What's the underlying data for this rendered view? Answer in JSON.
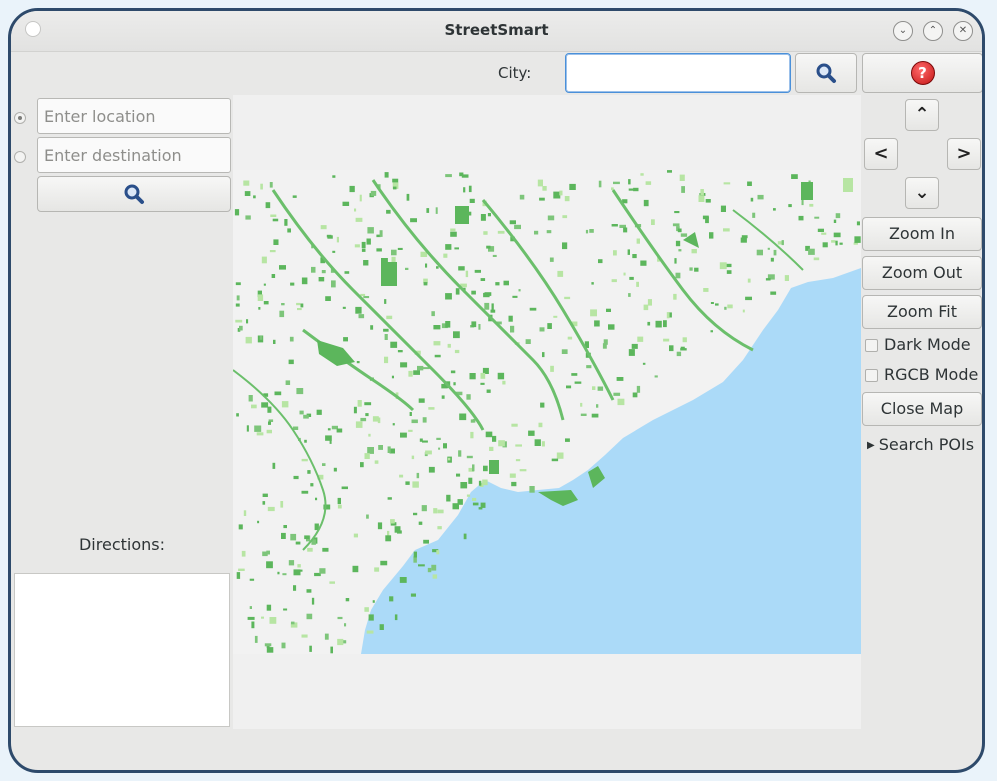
{
  "window": {
    "title": "StreetSmart"
  },
  "window_controls": [
    "minimize-icon",
    "maximize-icon",
    "close-icon"
  ],
  "search": {
    "city_label": "City:",
    "city_value": "",
    "city_placeholder": ""
  },
  "route": {
    "location_placeholder": "Enter location",
    "destination_placeholder": "Enter destination",
    "directions_label": "Directions:"
  },
  "controls": {
    "zoom_in": "Zoom In",
    "zoom_out": "Zoom Out",
    "zoom_fit": "Zoom Fit",
    "dark_mode": "Dark Mode",
    "rgcb_mode": "RGCB Mode",
    "close_map": "Close Map",
    "search_pois": "Search POIs",
    "pan_up": "⌃",
    "pan_down": "⌄",
    "pan_left": "<",
    "pan_right": ">",
    "help": "?"
  },
  "colors": {
    "land": "#f2f2f2",
    "water": "#abdaf8",
    "park": "#5cb65c",
    "grass": "#b7e5a3",
    "accent": "#4a90d9"
  }
}
